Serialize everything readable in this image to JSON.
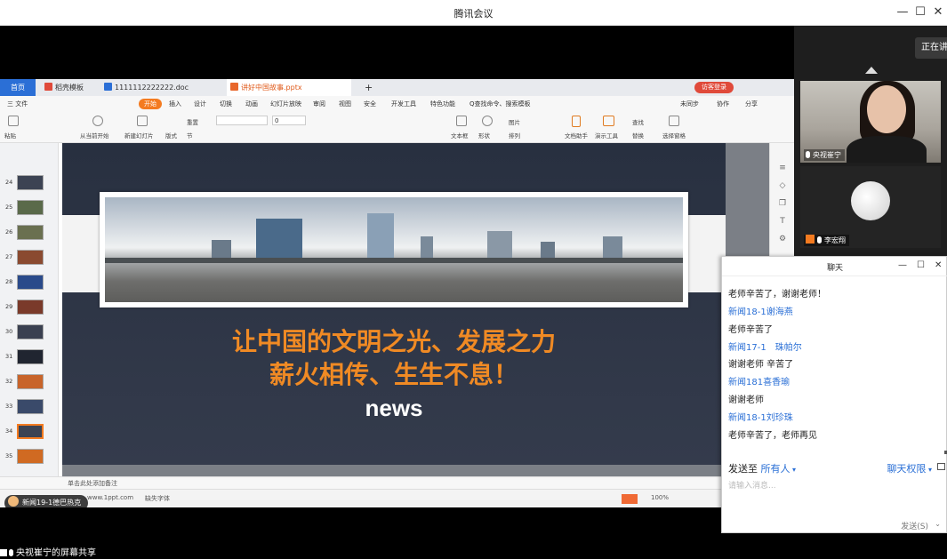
{
  "app": {
    "title": "腾讯会议"
  },
  "side": {
    "speaking_label": "正在讲话",
    "tiles": [
      {
        "name": "央视崔宁"
      },
      {
        "name": "李宏翔"
      }
    ]
  },
  "wps": {
    "tabs": [
      {
        "label": "首页"
      },
      {
        "label": "稻壳模板"
      },
      {
        "label": "1111112222222.doc"
      },
      {
        "label": "讲好中国故事.pptx"
      }
    ],
    "new_tab": "+",
    "login": "访客登录",
    "menus": [
      "三 文件",
      "开始",
      "插入",
      "设计",
      "切换",
      "动画",
      "幻灯片放映",
      "审阅",
      "视图",
      "安全",
      "开发工具",
      "特色功能",
      "Q查找命令、搜索模板"
    ],
    "menu_right": [
      "未同步",
      "协作",
      "分享"
    ],
    "toolbar_labels": [
      "粘贴",
      "从当前开始",
      "新建幻灯片",
      "版式",
      "节",
      "重置",
      "文本框",
      "形状",
      "排列",
      "图片",
      "文档助手",
      "演示工具",
      "查找",
      "替换",
      "选择窗格"
    ],
    "font_size": "0",
    "thumbs": [
      "24",
      "25",
      "26",
      "27",
      "28",
      "29",
      "30",
      "31",
      "32",
      "33",
      "34",
      "35"
    ],
    "slide": {
      "line1": "让中国的文明之光、发展之力",
      "line2": "薪火相传、生生不息！",
      "line3": "news"
    },
    "notes_placeholder": "单击此处添加备注",
    "status": {
      "site": "www.1ppt.com",
      "missing_font": "缺失字体",
      "zoom": "100%"
    }
  },
  "overlay": {
    "active_name": "新闻19-1德巴热克",
    "share_caption": "央视崔宁的屏幕共享"
  },
  "chat": {
    "title": "聊天",
    "messages": [
      {
        "kind": "text",
        "text": "老师辛苦了，谢谢老师！"
      },
      {
        "kind": "name",
        "text": "新闻18-1谢海燕"
      },
      {
        "kind": "text",
        "text": "老师辛苦了"
      },
      {
        "kind": "name",
        "text": "新闻17-1　珠帕尔"
      },
      {
        "kind": "text",
        "text": "谢谢老师 辛苦了"
      },
      {
        "kind": "name",
        "text": "新闻181喜香瑜"
      },
      {
        "kind": "text",
        "text": "谢谢老师"
      },
      {
        "kind": "name",
        "text": "新闻18-1刘珍珠"
      },
      {
        "kind": "text",
        "text": "老师辛苦了，老师再见"
      }
    ],
    "send_to_label": "发送至",
    "send_to_value": "所有人",
    "permission": "聊天权限",
    "input_placeholder": "请输入消息...",
    "send_button": "发送(S)"
  }
}
